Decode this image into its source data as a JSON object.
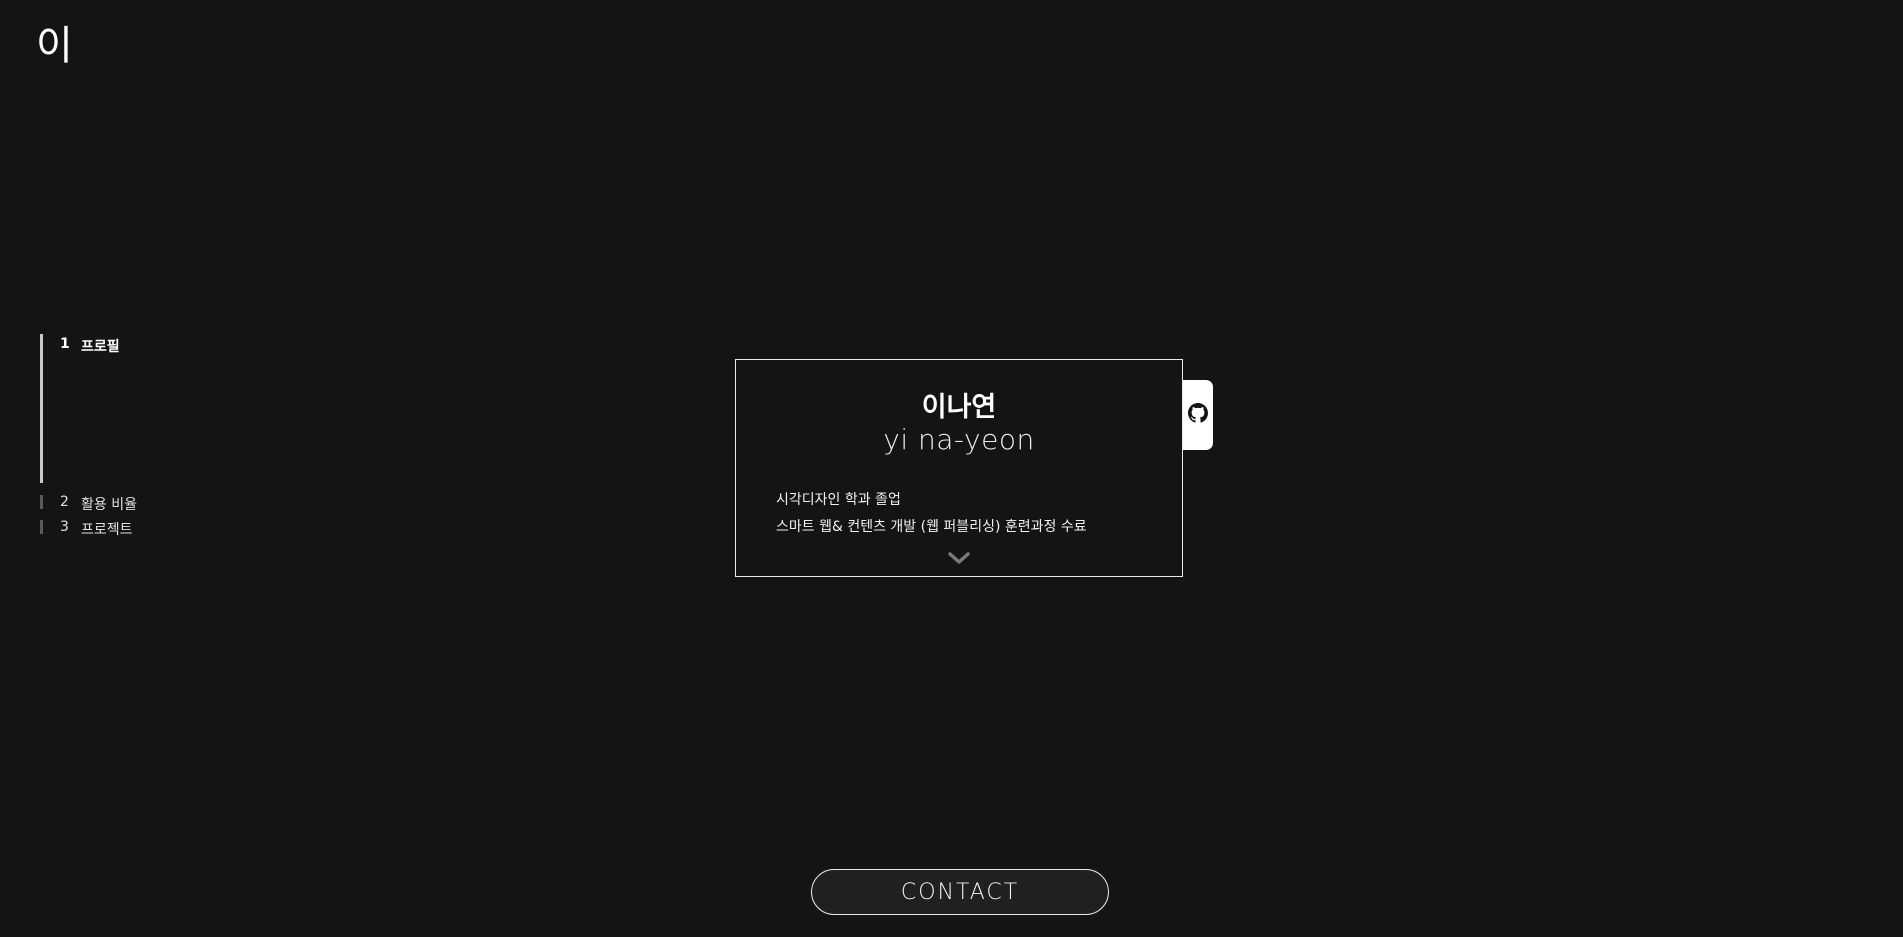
{
  "logo": {
    "text": "이"
  },
  "section_nav": {
    "items": [
      {
        "number": "1",
        "label": "프로필",
        "active": true
      },
      {
        "number": "2",
        "label": "활용 비율",
        "active": false
      },
      {
        "number": "3",
        "label": "프로젝트",
        "active": false
      }
    ]
  },
  "profile": {
    "name_korean": "이나연",
    "name_roman": "yi na-yeon",
    "lines": [
      "시각디자인 학과 졸업",
      "스마트 웹& 컨텐츠 개발 (웹 퍼블리싱) 훈련과정 수료"
    ]
  },
  "github_tab": {
    "icon": "github-icon"
  },
  "scroll_indicator": {
    "icon": "chevron-down-icon"
  },
  "contact": {
    "label": "CONTACT"
  },
  "colors": {
    "background": "#141414",
    "text": "#ffffff",
    "nav_active_bar": "#c8c8c8",
    "nav_inactive_bar": "#5a5a5a",
    "card_border": "#e8e8e8"
  }
}
